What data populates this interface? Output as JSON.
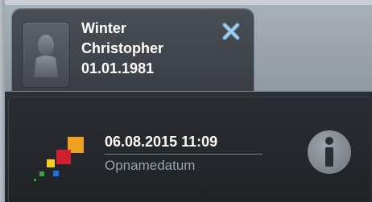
{
  "patient": {
    "last_name": "Winter",
    "first_name": "Christopher",
    "birth_date": "01.01.1981",
    "avatar_icon": "person-silhouette-icon",
    "close_icon": "close-x-icon"
  },
  "acquisition": {
    "datetime": "06.08.2015 11:09",
    "label": "Opnamedatum",
    "info_icon": "info-icon"
  },
  "colors": {
    "close_icon": "#7fb4d8",
    "logo_orange": "#f0a020",
    "logo_red": "#d02030",
    "logo_yellow": "#f2d21a",
    "logo_blue": "#2a6fd0",
    "logo_green": "#3aa040",
    "info_icon": "#8a8f94"
  }
}
